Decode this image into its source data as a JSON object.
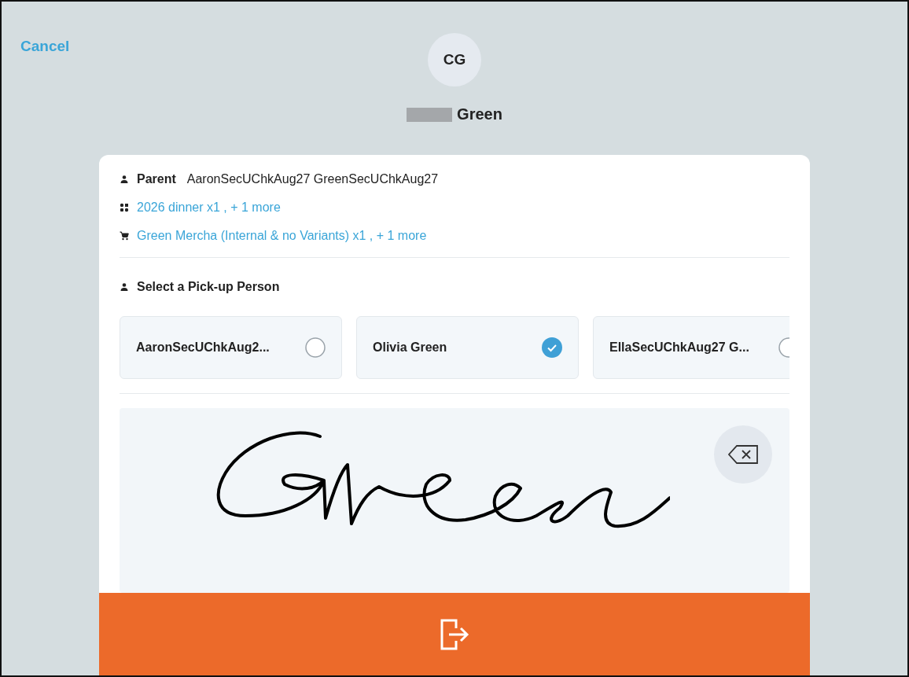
{
  "cancel": "Cancel",
  "avatar": {
    "initials": "CG"
  },
  "person": {
    "name": "Green",
    "redacted": true
  },
  "details": [
    {
      "kind": "parent",
      "label": "Parent",
      "value": "AaronSecUChkAug27 GreenSecUChkAug27"
    },
    {
      "kind": "tickets",
      "value": "2026 dinner x1 , + 1 more"
    },
    {
      "kind": "merch",
      "value": "Green Mercha (Internal & no Variants) x1 , + 1 more"
    }
  ],
  "pickup": {
    "heading": "Select a Pick-up Person",
    "people": [
      {
        "name": "AaronSecUChkAug2...",
        "selected": false
      },
      {
        "name": "Olivia Green",
        "selected": true
      },
      {
        "name": "EllaSecUChkAug27 G...",
        "selected": false
      }
    ]
  },
  "signature": {
    "signed": true
  }
}
